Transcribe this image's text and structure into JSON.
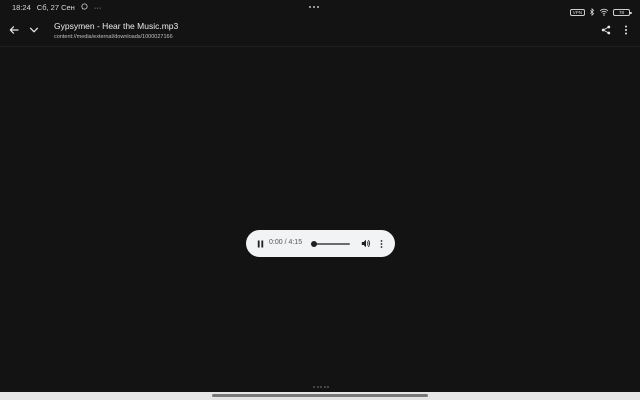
{
  "status_bar": {
    "time": "18:24",
    "date": "Сб, 27 Сен",
    "notification_icons": [
      "whatsapp-icon"
    ],
    "overflow": "···",
    "vpn_label": "VPN",
    "battery_level": "78"
  },
  "title_bar": {
    "file_name": "Gypsymen - Hear the Music.mp3",
    "file_uri": "content://media/external/downloads/1000027166"
  },
  "player": {
    "time_display": "0:00 / 4:15",
    "progress_fraction": 0.0,
    "state": "playing"
  },
  "colors": {
    "background": "#131313",
    "player_background": "#f1f3f4",
    "text_primary": "#ececec"
  }
}
